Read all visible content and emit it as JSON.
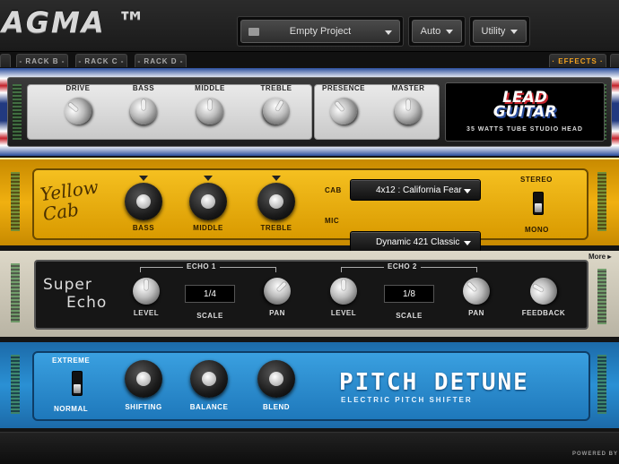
{
  "header": {
    "logo": "AGMA ™",
    "project": "Empty Project",
    "auto": "Auto",
    "utility": "Utility"
  },
  "tabs": [
    {
      "label": "- RACK B -"
    },
    {
      "label": "- RACK C -"
    },
    {
      "label": "- RACK D -"
    }
  ],
  "effects_tab": "· EFFECTS ·",
  "lead_guitar": {
    "knobs": [
      {
        "label": "DRIVE"
      },
      {
        "label": "BASS"
      },
      {
        "label": "MIDDLE"
      },
      {
        "label": "TREBLE"
      },
      {
        "label": "PRESENCE"
      },
      {
        "label": "MASTER"
      }
    ],
    "logo_line1": "LEAD",
    "logo_line2": "GUITAR",
    "subtitle": "35 WATTS TUBE STUDIO HEAD"
  },
  "yellow_cab": {
    "logo": "Yellow Cab",
    "knobs": [
      {
        "label": "BASS"
      },
      {
        "label": "MIDDLE"
      },
      {
        "label": "TREBLE"
      }
    ],
    "cab_label": "CAB",
    "cab_value": "4x12 : California Fear",
    "mic_label": "MIC",
    "mic_value": "Dynamic 421 Classic",
    "stereo": "STEREO",
    "mono": "MONO"
  },
  "super_echo": {
    "more": "More",
    "logo_line1": "Super",
    "logo_line2": "Echo",
    "echo1": "ECHO 1",
    "echo2": "ECHO 2",
    "echo1_scale": "1/4",
    "echo2_scale": "1/8",
    "level": "LEVEL",
    "scale": "SCALE",
    "pan": "PAN",
    "feedback": "FEEDBACK"
  },
  "pitch_detune": {
    "extreme": "EXTREME",
    "normal": "NORMAL",
    "knobs": [
      {
        "label": "SHIFTING"
      },
      {
        "label": "BALANCE"
      },
      {
        "label": "BLEND"
      }
    ],
    "title": "PITCH DETUNE",
    "subtitle": "ELECTRIC PITCH SHIFTER"
  },
  "footer": {
    "powered_by": "POWERED BY"
  }
}
